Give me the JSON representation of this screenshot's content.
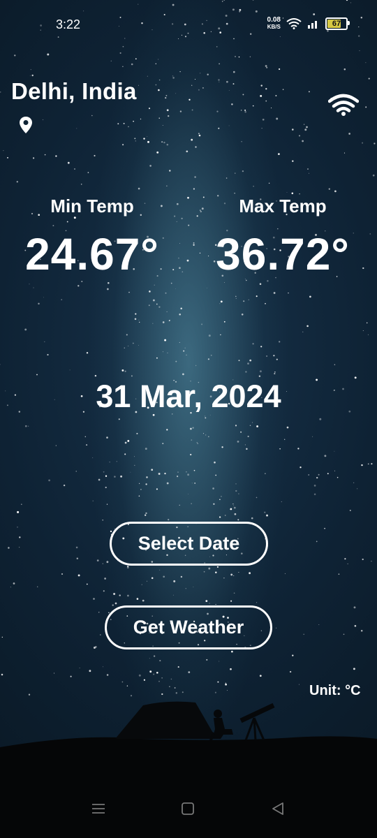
{
  "status_bar": {
    "time": "3:22",
    "speed_value": "0.08",
    "speed_unit": "KB/S",
    "battery": "67"
  },
  "location": {
    "city": "Delhi, India"
  },
  "min_temp": {
    "label": "Min Temp",
    "value": "24.67°"
  },
  "max_temp": {
    "label": "Max Temp",
    "value": "36.72°"
  },
  "date": "31 Mar, 2024",
  "buttons": {
    "select_date": "Select Date",
    "get_weather": "Get Weather"
  },
  "unit_label": "Unit: °C",
  "icons": {
    "location": "location-pin-icon",
    "wifi": "wifi-icon",
    "nav_menu": "menu-icon",
    "nav_home": "home-square-icon",
    "nav_back": "back-triangle-icon"
  },
  "colors": {
    "sky_dark": "#0a1824",
    "milky_way": "#5a96aa",
    "battery": "#d6c843",
    "text": "#ffffff"
  }
}
